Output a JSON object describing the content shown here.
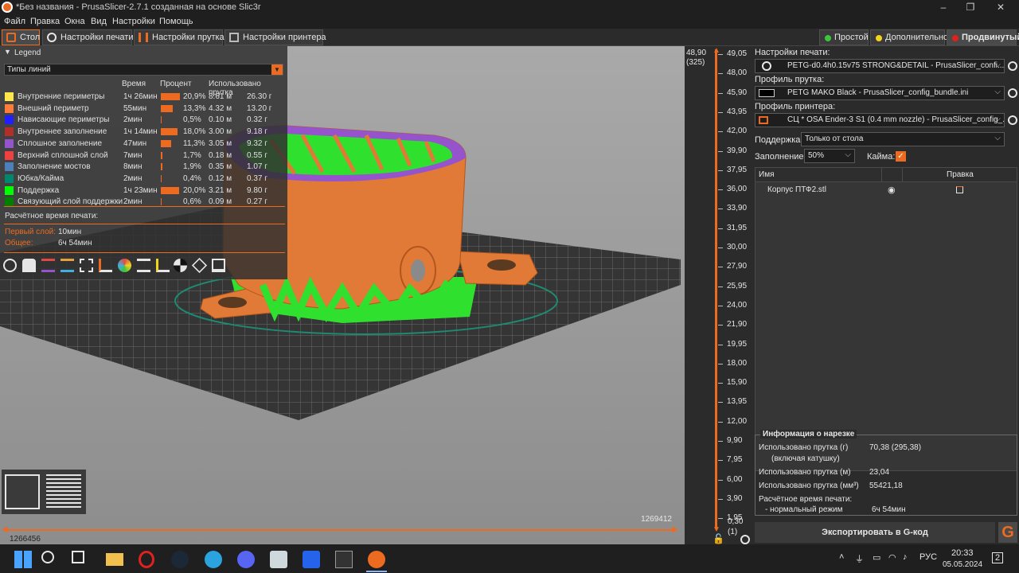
{
  "window": {
    "title": "*Без названия - PrusaSlicer-2.7.1 созданная на основе Slic3r"
  },
  "menu": [
    "Файл",
    "Правка",
    "Окна",
    "Вид",
    "Настройки",
    "Помощь"
  ],
  "tabs": [
    "Стол",
    "Настройки печати",
    "Настройки прутка",
    "Настройки принтера"
  ],
  "modes": [
    {
      "label": "Простой",
      "color": "#3ec33e"
    },
    {
      "label": "Дополнительно",
      "color": "#f2d31d"
    },
    {
      "label": "Продвинутый",
      "color": "#e02121"
    }
  ],
  "legend": {
    "title": "Legend",
    "view_type": "Типы линий",
    "headers": {
      "time": "Время",
      "percent": "Процент",
      "used": "Использовано прутка"
    },
    "rows": [
      {
        "name": "Внутренние периметры",
        "color": "#ffe64d",
        "time": "1ч 26мин",
        "pct": "20,9%",
        "pct_value": 20.9,
        "m": "8.61 м",
        "g": "26.30 г"
      },
      {
        "name": "Внешний периметр",
        "color": "#ff7d38",
        "time": "55мин",
        "pct": "13,3%",
        "pct_value": 13.3,
        "m": "4.32 м",
        "g": "13.20 г"
      },
      {
        "name": "Нависающие периметры",
        "color": "#1f1fff",
        "time": "2мин",
        "pct": "0,5%",
        "pct_value": 0.5,
        "m": "0.10 м",
        "g": "0.32 г"
      },
      {
        "name": "Внутреннее заполнение",
        "color": "#b03029",
        "time": "1ч 14мин",
        "pct": "18,0%",
        "pct_value": 18.0,
        "m": "3.00 м",
        "g": "9.18 г"
      },
      {
        "name": "Сплошное заполнение",
        "color": "#9654cc",
        "time": "47мин",
        "pct": "11,3%",
        "pct_value": 11.3,
        "m": "3.05 м",
        "g": "9.32 г"
      },
      {
        "name": "Верхний сплошной слой",
        "color": "#f04040",
        "time": "7мин",
        "pct": "1,7%",
        "pct_value": 1.7,
        "m": "0.18 м",
        "g": "0.55 г"
      },
      {
        "name": "Заполнение мостов",
        "color": "#4d80ba",
        "time": "8мин",
        "pct": "1,9%",
        "pct_value": 1.9,
        "m": "0.35 м",
        "g": "1.07 г"
      },
      {
        "name": "Юбка/Кайма",
        "color": "#00876e",
        "time": "2мин",
        "pct": "0,4%",
        "pct_value": 0.4,
        "m": "0.12 м",
        "g": "0.37 г"
      },
      {
        "name": "Поддержка",
        "color": "#00ff00",
        "time": "1ч 23мин",
        "pct": "20,0%",
        "pct_value": 20.0,
        "m": "3.21 м",
        "g": "9.80 г"
      },
      {
        "name": "Связующий слой поддержки",
        "color": "#008000",
        "time": "2мин",
        "pct": "0,6%",
        "pct_value": 0.6,
        "m": "0.09 м",
        "g": "0.27 г"
      }
    ],
    "estimated": "Расчётное время печати:",
    "first_layer_label": "Первый слой:",
    "first_layer": "10мин",
    "total_label": "Общее:",
    "total": "6ч 54мин"
  },
  "viewport": {
    "bottom_right_value": "1269412",
    "bottom_left_value": "1266456"
  },
  "layer_slider": {
    "top_a": "48,90",
    "top_b": "(325)",
    "bottom_a": "0,30",
    "bottom_b": "(1)",
    "ticks": [
      "49,05",
      "48,00",
      "45,90",
      "43,95",
      "42,00",
      "39,90",
      "37,95",
      "36,00",
      "33,90",
      "31,95",
      "30,00",
      "27,90",
      "25,95",
      "24,00",
      "21,90",
      "19,95",
      "18,00",
      "15,90",
      "13,95",
      "12,00",
      "9,90",
      "7,95",
      "6,00",
      "3,90",
      "1,95"
    ]
  },
  "right": {
    "print_label": "Настройки печати:",
    "print_value": "PETG-d0.4h0.15v75 STRONG&DETAIL - PrusaSlicer_confi...",
    "filament_label": "Профиль прутка:",
    "filament_value": "PETG MAKO Black - PrusaSlicer_config_bundle.ini",
    "printer_label": "Профиль принтера:",
    "printer_value": "СЦ * OSA Ender-3 S1 (0.4 mm nozzle) - PrusaSlicer_config_...",
    "support_label": "Поддержка:",
    "support_value": "Только от стола",
    "infill_label": "Заполнение:",
    "infill_value": "50%",
    "brim_label": "Кайма:",
    "col_name": "Имя",
    "col_edit": "Правка",
    "object": "Корпус ПТФ2.stl",
    "info_title": "Информация о нарезке",
    "info": [
      {
        "k": "Использовано прутка (г)",
        "k2": "(включая катушку)",
        "v": "70,38 (295,38)"
      },
      {
        "k": "Использовано прутка (м)",
        "v": "23,04"
      },
      {
        "k": "Использовано прутка (мм³)",
        "v": "55421,18"
      },
      {
        "k": "Расчётное время печати:",
        "v": ""
      },
      {
        "k": "- нормальный режим",
        "v": "6ч 54мин"
      }
    ],
    "export": "Экспортировать в G-код",
    "export_icon": "G"
  },
  "taskbar": {
    "lang": "РУС",
    "time": "20:33",
    "date": "05.05.2024",
    "notif": "2"
  },
  "colors": {
    "accent": "#ed6b21",
    "model": "#e07a36",
    "support": "#2fe02f"
  }
}
